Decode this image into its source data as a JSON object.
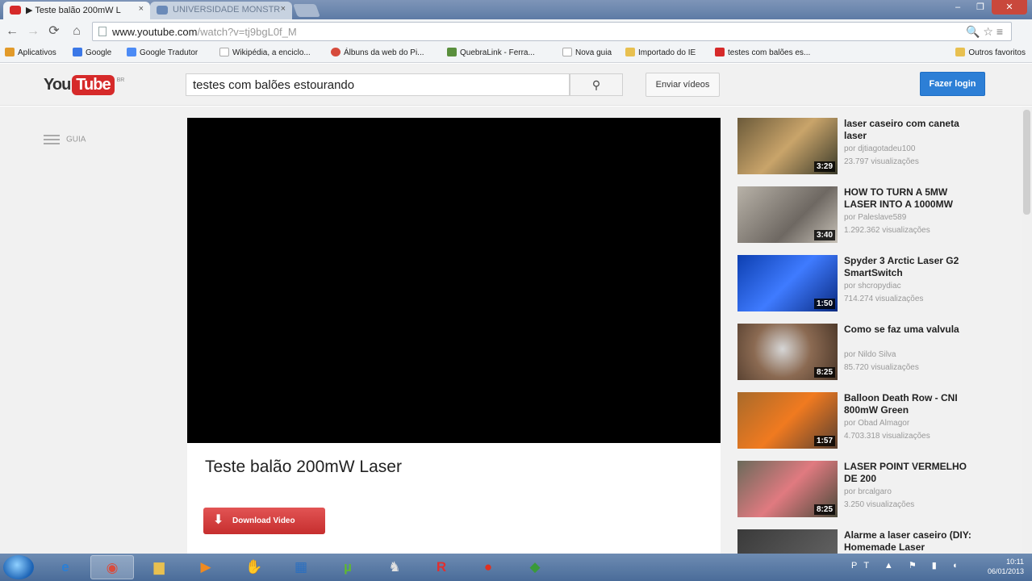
{
  "browser": {
    "tabs": [
      {
        "label": "▶ Teste balão 200mW L",
        "active": true
      },
      {
        "label": "UNIVERSIDADE MONSTR",
        "active": false
      }
    ],
    "close_glyph": "×",
    "nav": {
      "back": "←",
      "forward": "→",
      "reload": "⟳",
      "home": "⌂"
    },
    "url": {
      "host": "www.youtube.com",
      "path": "/watch?v=tj9bgL0f_M"
    },
    "omni_icons": "🔍 ☆ ≡",
    "bookmarks": [
      {
        "label": "Aplicativos",
        "color": "#e29a2a"
      },
      {
        "label": "Google",
        "color": "#3b78e7"
      },
      {
        "label": "Google Tradutor",
        "color": "#4c8bf5"
      },
      {
        "label": "Wikipédia, a enciclo...",
        "color": "#ffffff"
      },
      {
        "label": "Álbuns da web do Pi...",
        "color": "#d64b3c"
      },
      {
        "label": "QuebraLink - Ferra...",
        "color": "#5a8f3d"
      },
      {
        "label": "Nova guia",
        "color": "#ffffff"
      },
      {
        "label": "Importado do IE",
        "color": "#e8c050"
      },
      {
        "label": "testes com balões es...",
        "color": "#d62a2a"
      }
    ],
    "other_bookmarks": "Outros favoritos"
  },
  "youtube": {
    "logo": {
      "you": "You",
      "tube": "Tube",
      "locale": "BR"
    },
    "search": {
      "value": "testes com balões estourando"
    },
    "upload_label": "Enviar vídeos",
    "login_label": "Fazer login",
    "guide_label": "GUIA",
    "video_title": "Teste balão 200mW Laser",
    "download_label": "Download Video",
    "related": [
      {
        "title": "laser caseiro com caneta laser",
        "author": "por djtiagotadeu100",
        "views": "23.797 visualizações",
        "duration": "3:29",
        "thumb": "linear-gradient(135deg,#6b5a3a,#c9a46a 50%,#3a3a2a)"
      },
      {
        "title": "HOW TO TURN A 5MW LASER INTO A 1000MW",
        "author": "por Paleslave589",
        "views": "1.292.362 visualizações",
        "duration": "3:40",
        "thumb": "linear-gradient(135deg,#b8b2a8,#6e6862 60%,#c8c2b8)"
      },
      {
        "title": "Spyder 3 Arctic Laser G2 SmartSwitch",
        "author": "por shcropydiac",
        "views": "714.274 visualizações",
        "duration": "1:50",
        "thumb": "linear-gradient(135deg,#0d3fb0,#3f7bff 50%,#0a2a80)"
      },
      {
        "title": "Como se faz uma valvula",
        "author": "por Nildo Silva",
        "views": "85.720 visualizações",
        "duration": "8:25",
        "thumb": "radial-gradient(circle at 45% 45%,#d6d6d6,#8b6a52 45%,#4a3628)"
      },
      {
        "title": "Balloon Death Row - CNI 800mW Green",
        "author": "por Obad Almagor",
        "views": "4.703.318 visualizações",
        "duration": "1:57",
        "thumb": "linear-gradient(135deg,#a86a2a,#f07a20 50%,#5a4030)"
      },
      {
        "title": "LASER POINT VERMELHO DE 200",
        "author": "por brcalgaro",
        "views": "3.250 visualizações",
        "duration": "8:25",
        "thumb": "linear-gradient(135deg,#6a6a5a,#e07a80 50%,#4a4a3a)"
      },
      {
        "title": "Alarme a laser caseiro (DIY: Homemade Laser",
        "author": "",
        "views": "",
        "duration": "",
        "thumb": "linear-gradient(135deg,#3a3a3a,#6a6a6a)"
      }
    ]
  },
  "taskbar": {
    "apps": [
      {
        "name": "ie",
        "glyph": "e",
        "color": "#2a7fd6"
      },
      {
        "name": "chrome",
        "glyph": "◉",
        "color": "#d94c3c"
      },
      {
        "name": "explorer",
        "glyph": "▆",
        "color": "#e8c050"
      },
      {
        "name": "media-player",
        "glyph": "▶",
        "color": "#f08a20"
      },
      {
        "name": "app5",
        "glyph": "✋",
        "color": "#d88030"
      },
      {
        "name": "app6",
        "glyph": "▦",
        "color": "#2a6fc0"
      },
      {
        "name": "utorrent",
        "glyph": "µ",
        "color": "#5fb832"
      },
      {
        "name": "app8",
        "glyph": "♞",
        "color": "#e0e0e0"
      },
      {
        "name": "app9",
        "glyph": "R",
        "color": "#e03030"
      },
      {
        "name": "app10",
        "glyph": "●",
        "color": "#e03020"
      },
      {
        "name": "app11",
        "glyph": "◆",
        "color": "#3a9a3a"
      }
    ],
    "tray_icons": "PT ▲ ⚑ ▮ ◖",
    "time": "10:11",
    "date": "06/01/2013"
  }
}
